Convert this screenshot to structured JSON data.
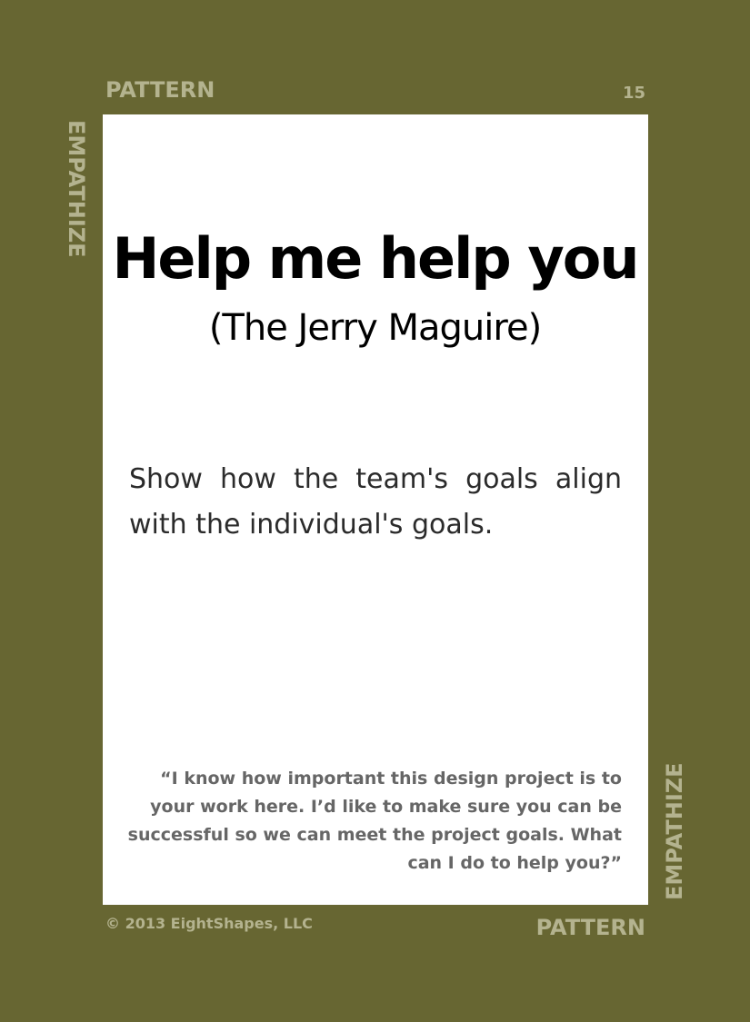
{
  "card": {
    "category_label": "PATTERN",
    "page_number": "15",
    "side_label": "EMPATHIZE",
    "title": "Help me help you",
    "subtitle": "(The Jerry Maguire)",
    "description": "Show how the team's goals align with the individual's goals.",
    "quote": "“I know how important this design project is to your work here. I’d like to make sure you can be successful so we can meet the project goals. What can I do to help you?”",
    "copyright": "© 2013 EightShapes, LLC"
  },
  "colors": {
    "background": "#676632",
    "panel": "#ffffff",
    "label": "#b4b38f",
    "title": "#000000",
    "body": "#2b2b2b",
    "quote": "#666666"
  }
}
